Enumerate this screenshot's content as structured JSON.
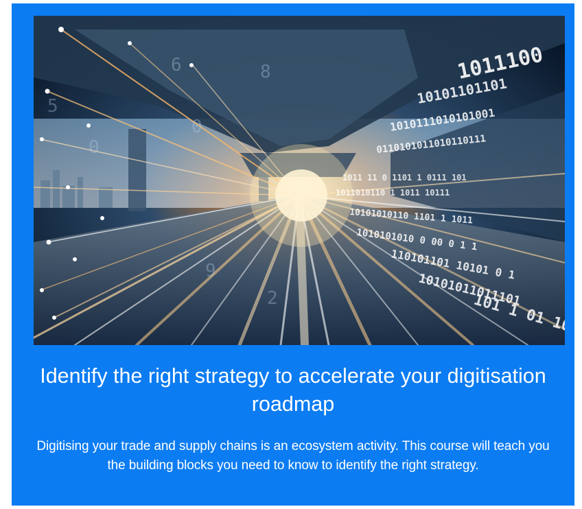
{
  "card": {
    "background": "#0c7cf2",
    "image_icon": "digital-speed-highway-image",
    "title": "Identify the right strategy to accelerate your digitisation roadmap",
    "description": "Digitising your trade and supply chains is an ecosystem activity. This course will teach you the building blocks you need to know to identify the right strategy."
  }
}
